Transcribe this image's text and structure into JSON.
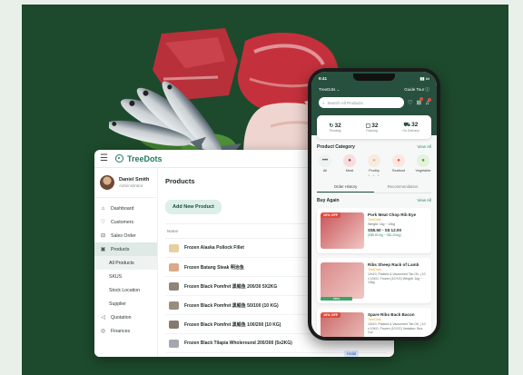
{
  "desktop": {
    "brand": "TreeDots",
    "user": {
      "name": "Daniel Smith",
      "role": "Administrator"
    },
    "nav": [
      {
        "label": "Dashboard",
        "icon": "home-icon",
        "glyph": "⌂",
        "active": false,
        "sub": false
      },
      {
        "label": "Customers",
        "icon": "heart-icon",
        "glyph": "♡",
        "active": false,
        "sub": false
      },
      {
        "label": "Sales Order",
        "icon": "cart-icon",
        "glyph": "⊟",
        "active": false,
        "sub": false
      },
      {
        "label": "Products",
        "icon": "box-icon",
        "glyph": "▣",
        "active": true,
        "sub": false
      },
      {
        "label": "All Products",
        "icon": "",
        "glyph": "",
        "active": true,
        "sub": true
      },
      {
        "label": "SKUS",
        "icon": "",
        "glyph": "",
        "active": false,
        "sub": true
      },
      {
        "label": "Stock Location",
        "icon": "",
        "glyph": "",
        "active": false,
        "sub": true
      },
      {
        "label": "Supplier",
        "icon": "",
        "glyph": "",
        "active": false,
        "sub": true
      },
      {
        "label": "Quotation",
        "icon": "megaphone-icon",
        "glyph": "◁",
        "active": false,
        "sub": false
      },
      {
        "label": "Finances",
        "icon": "coin-icon",
        "glyph": "◎",
        "active": false,
        "sub": false
      }
    ],
    "page_title": "Products",
    "add_button": "Add New Product",
    "column_name": "Name",
    "products": [
      {
        "name": "Frozen Alaska Pollock Fillet",
        "color": "#e8cfa2"
      },
      {
        "name": "Frozen Batang Steak 明治鱼",
        "color": "#d9a98a"
      },
      {
        "name": "Frozen Black Pomfret 黑鲳鱼 200/30 5X2KG",
        "color": "#8f8478"
      },
      {
        "name": "Frozen Black Pomfret 黑鲳鱼 50/100 (10 KG)",
        "color": "#9a8d80"
      },
      {
        "name": "Frozen Black Pomfret 黑鲳鱼 100/200 (10 KG)",
        "color": "#857a70"
      },
      {
        "name": "Frozen Black Tilapia Wholeround 200/300 (5x2KG)",
        "color": "#a4a7ad"
      }
    ],
    "badge": "Halal"
  },
  "phone": {
    "time": "9:41",
    "brand": "TreeDots",
    "guide": "Guide Tour",
    "search_placeholder": "Search All Products",
    "stats": [
      {
        "value": "32",
        "label": "Pending",
        "icon": "refresh-icon",
        "glyph": "↻"
      },
      {
        "value": "32",
        "label": "Packing",
        "icon": "package-icon",
        "glyph": "▢"
      },
      {
        "value": "32",
        "label": "On Delivery",
        "icon": "truck-icon",
        "glyph": "⛟"
      }
    ],
    "category_title": "Product Category",
    "view_all": "View All",
    "categories": [
      {
        "label": "All",
        "icon": "more-icon",
        "glyph": "•••",
        "bg": "#eef2f0",
        "fg": "#27503e"
      },
      {
        "label": "Meat",
        "icon": "meat-icon",
        "glyph": "●",
        "bg": "#f6dede",
        "fg": "#b23a3a"
      },
      {
        "label": "Poultry",
        "icon": "poultry-icon",
        "glyph": "●",
        "bg": "#f7ece0",
        "fg": "#e3b38a"
      },
      {
        "label": "Seafood",
        "icon": "seafood-icon",
        "glyph": "●",
        "bg": "#fde6df",
        "fg": "#e0553a"
      },
      {
        "label": "Vegetable",
        "icon": "vegetable-icon",
        "glyph": "●",
        "bg": "#e4f2dc",
        "fg": "#4f9a3a"
      }
    ],
    "tabs": [
      "Order History",
      "Recommendation"
    ],
    "buy_again": "Buy Again",
    "buy_view_all": "View All",
    "products": [
      {
        "off": "16% OFF",
        "name": "Pork Meat Chop Rib Eye",
        "brand": "TreeDots",
        "detail": "Weight: 1kg ~ 10kg",
        "price": "S$5.50 - S$ 12.00",
        "unit": "(S$5.50 /kg ~ S$1.20/kg)",
        "img": "#c9545a",
        "new": ""
      },
      {
        "off": "",
        "name": "Ribs Sheep Rack of Lamb",
        "brand": "TreeDots",
        "detail": "10x10, Packed & Vacuumed Tan Ok, | 10 x 10KG, Frozen (10 KG) Weight: 1kg ~ 10kg",
        "price": "",
        "unit": "",
        "img": "#d88a8a",
        "new": "New"
      },
      {
        "off": "16% OFF",
        "name": "Spare Ribs Back Bacon",
        "brand": "TreeDots",
        "detail": "10x10, Packed & Vacuumed Tan Ok, | 10 x 10KG, Frozen (10 KG) Variation: Box, Cut",
        "price": "",
        "unit": "",
        "img": "#c96a6a",
        "new": ""
      }
    ]
  },
  "colors": {
    "background": "#1d4a2c",
    "brand_green": "#27503e",
    "sale_red": "#e14a3a"
  }
}
